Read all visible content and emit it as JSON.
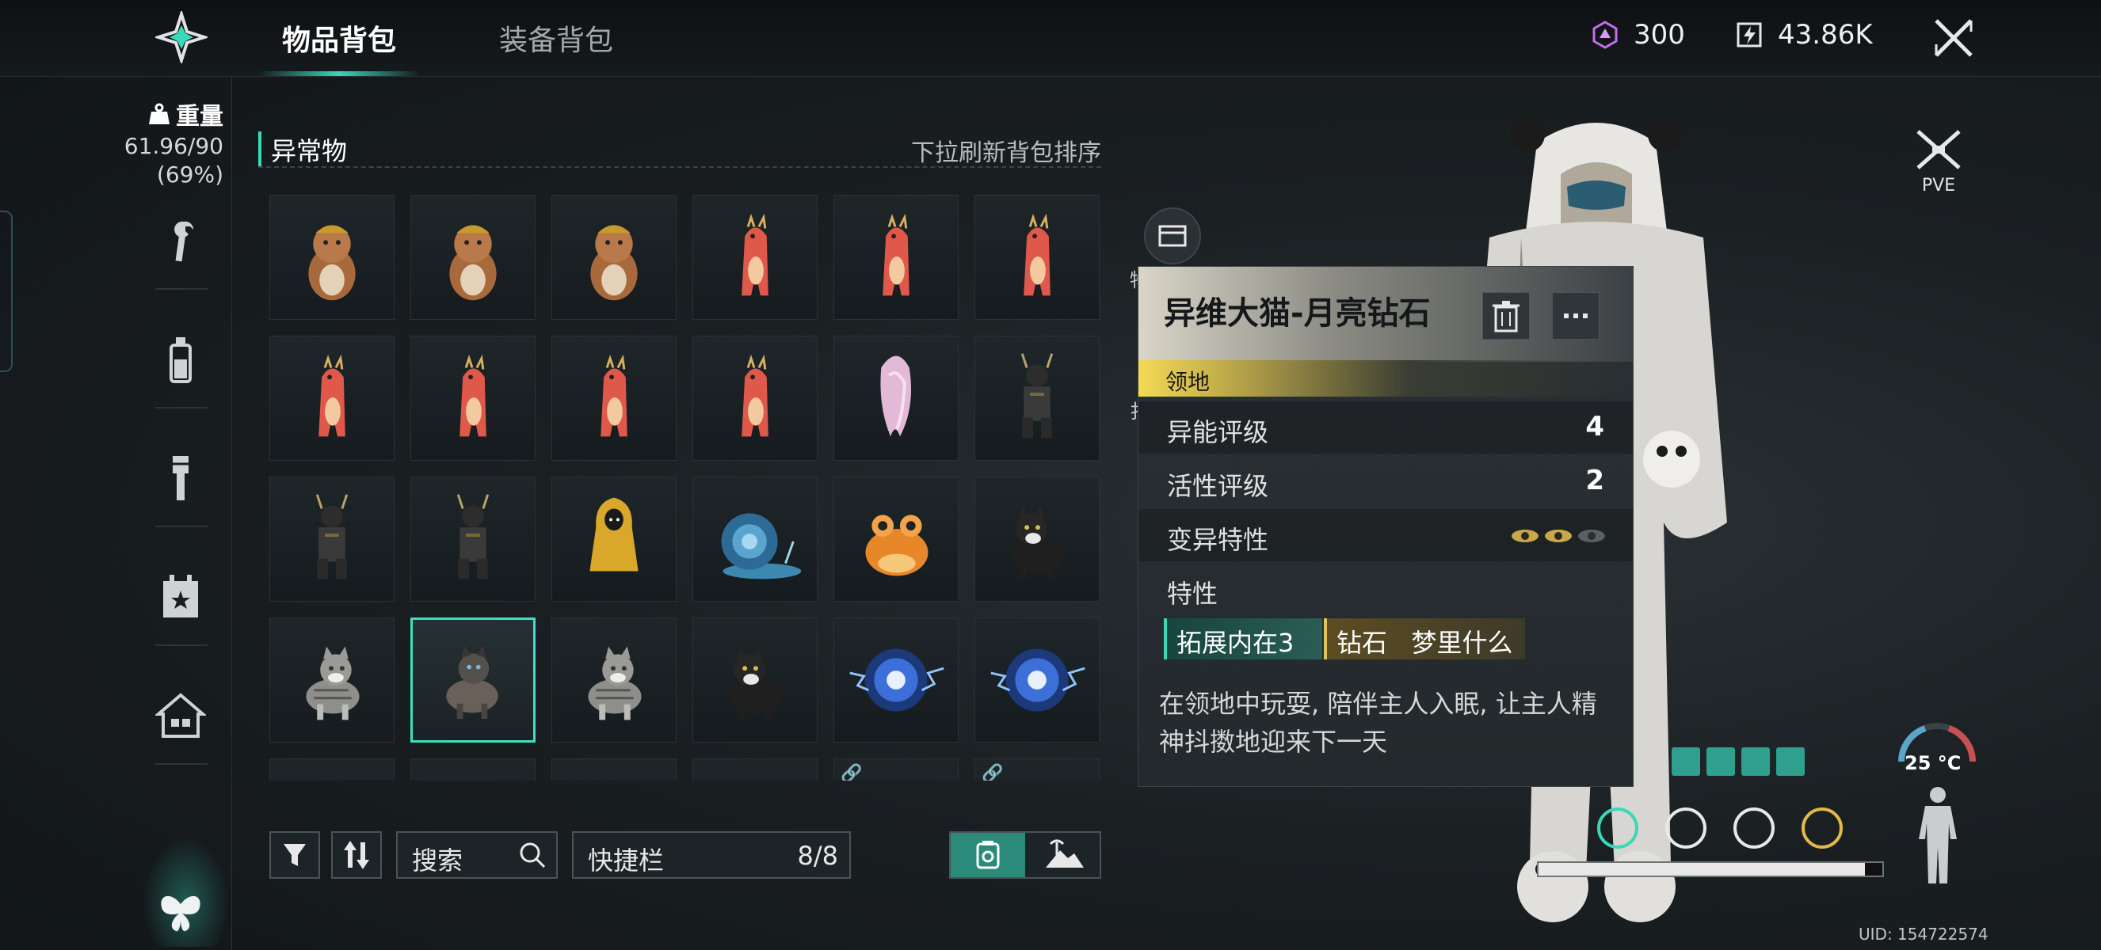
{
  "header": {
    "tabs": [
      {
        "label": "物品背包",
        "active": true
      },
      {
        "label": "装备背包",
        "active": false
      }
    ],
    "currency": [
      {
        "icon": "gem-icon",
        "value": "300"
      },
      {
        "icon": "energy-icon",
        "value": "43.86K"
      }
    ]
  },
  "sidebar": {
    "weight_label": "重量",
    "weight_value": "61.96/90",
    "weight_percent": "(69%)",
    "categories": [
      "wrench-icon",
      "bottle-icon",
      "torch-icon",
      "calendar-star-icon",
      "house-icon",
      "butterfly-icon"
    ]
  },
  "inventory": {
    "section_title": "异常物",
    "sort_hint": "下拉刷新背包排序",
    "items": [
      {
        "name": "beaver-hat"
      },
      {
        "name": "beaver-hat"
      },
      {
        "name": "beaver-hat"
      },
      {
        "name": "red-dragon"
      },
      {
        "name": "red-dragon"
      },
      {
        "name": "red-dragon"
      },
      {
        "name": "red-dragon"
      },
      {
        "name": "red-dragon"
      },
      {
        "name": "red-dragon"
      },
      {
        "name": "red-dragon"
      },
      {
        "name": "pink-ghost"
      },
      {
        "name": "samurai"
      },
      {
        "name": "samurai"
      },
      {
        "name": "samurai"
      },
      {
        "name": "yellow-raincoat"
      },
      {
        "name": "snail"
      },
      {
        "name": "orange-frog"
      },
      {
        "name": "black-cat"
      },
      {
        "name": "tabby-cat"
      },
      {
        "name": "siamese-cat",
        "selected": true
      },
      {
        "name": "tabby-cat"
      },
      {
        "name": "black-cat"
      },
      {
        "name": "blue-orb"
      },
      {
        "name": "blue-orb"
      },
      {
        "name": "partial"
      },
      {
        "name": "partial"
      },
      {
        "name": "partial"
      },
      {
        "name": "partial"
      },
      {
        "name": "partial",
        "linked": true
      },
      {
        "name": "partial",
        "linked": true
      }
    ]
  },
  "toolbar": {
    "search_placeholder": "搜索",
    "quickbar_label": "快捷栏",
    "quickbar_count": "8/8"
  },
  "tooltip": {
    "name": "异维大猫-月亮钻石",
    "tag": "领地",
    "rows": [
      {
        "label": "异能评级",
        "value": "4"
      },
      {
        "label": "活性评级",
        "value": "2"
      },
      {
        "label": "变异特性",
        "value": ""
      }
    ],
    "traits_label": "特性",
    "traits": [
      "拓展内在3",
      "钻石   梦里什么"
    ],
    "description": "在领地中玩耍, 陪伴主人入眠, 让主人精神抖擞地迎来下一天"
  },
  "hidden_labels": [
    "物",
    "扌"
  ],
  "right_panel": {
    "mode": "PVE",
    "temperature": "25 °C",
    "uid": "UID: 154722574",
    "stamina_fraction": 0.95
  },
  "colors": {
    "accent": "#38d8b8",
    "gold": "#e0c35a",
    "tag_yellow": "#f3da55"
  }
}
